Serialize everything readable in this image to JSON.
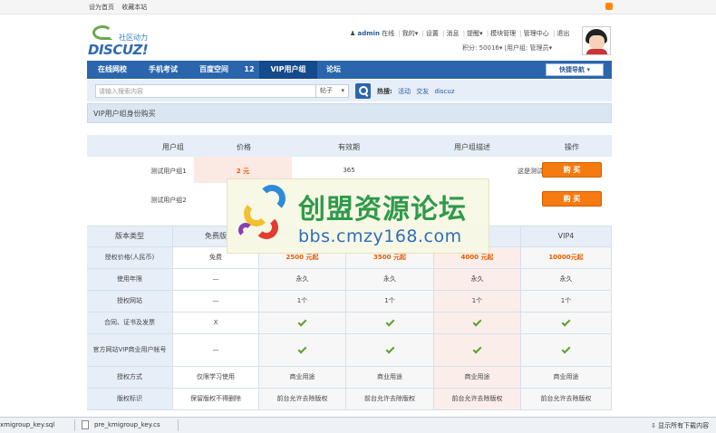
{
  "topbar": {
    "set_home": "设为首页",
    "bookmark": "收藏本站"
  },
  "logo": {
    "cn": "社区动力",
    "en": "DISCUZ!"
  },
  "user": {
    "name": "admin",
    "status": "在线",
    "links": [
      "我的",
      "设置",
      "消息",
      "提醒",
      "模块管理",
      "管理中心",
      "退出"
    ],
    "credits": "积分: 50016",
    "group": "用户组: 管理员"
  },
  "nav": {
    "items": [
      "在线网校",
      "手机考试",
      "百度空间",
      "12",
      "VIP用户组",
      "论坛"
    ],
    "active_index": 4,
    "quick_nav": "快捷导航"
  },
  "search": {
    "placeholder": "请输入搜索内容",
    "type": "帖子",
    "hot_label": "热搜:",
    "hot_words": [
      "活动",
      "交友",
      "discuz"
    ]
  },
  "page_title": "VIP用户组身份购买",
  "group_table": {
    "headers": [
      "用户组",
      "价格",
      "有效期",
      "用户组描述",
      "操作"
    ],
    "rows": [
      {
        "name": "测试用户组1",
        "price": "2 元",
        "period": "365",
        "desc": "这是测试用的1",
        "action": "购 买"
      },
      {
        "name": "测试用户组2",
        "price": "",
        "period": "",
        "desc": "2",
        "action": "购 买"
      }
    ]
  },
  "compare_table": {
    "headers": [
      "版本类型",
      "免费版",
      "",
      "",
      "",
      "VIP4"
    ],
    "rows": [
      {
        "label": "授权价格(人民币)",
        "cells": [
          "免费",
          "2500 元起",
          "3500 元起",
          "4000 元起",
          "10000元起"
        ]
      },
      {
        "label": "使用年限",
        "cells": [
          "—",
          "永久",
          "永久",
          "永久",
          "永久"
        ]
      },
      {
        "label": "授权网站",
        "cells": [
          "—",
          "1个",
          "1个",
          "1个",
          "1个"
        ]
      },
      {
        "label": "合同、证书及发票",
        "cells": [
          "X",
          "check",
          "check",
          "check",
          "check"
        ]
      },
      {
        "label": "官方网站VIP商业用户帐号",
        "cells": [
          "—",
          "check",
          "check",
          "check",
          "check"
        ]
      },
      {
        "label": "授权方式",
        "cells": [
          "仅限学习使用",
          "商业用途",
          "商业用途",
          "商业用途",
          "商业用途"
        ]
      },
      {
        "label": "版权标识",
        "cells": [
          "保留版权不得删除",
          "前台允许去除版权",
          "前台允许去除版权",
          "前台允许去除版权",
          "前台允许去除版权"
        ]
      }
    ]
  },
  "watermark": {
    "title": "创盟资源论坛",
    "url": "bbs.cmzy168.com"
  },
  "downloads": {
    "items": [
      "xmigroup_key.sql",
      "pre_kmigroup_key.cs"
    ],
    "show_all": "显示所有下载内容"
  }
}
